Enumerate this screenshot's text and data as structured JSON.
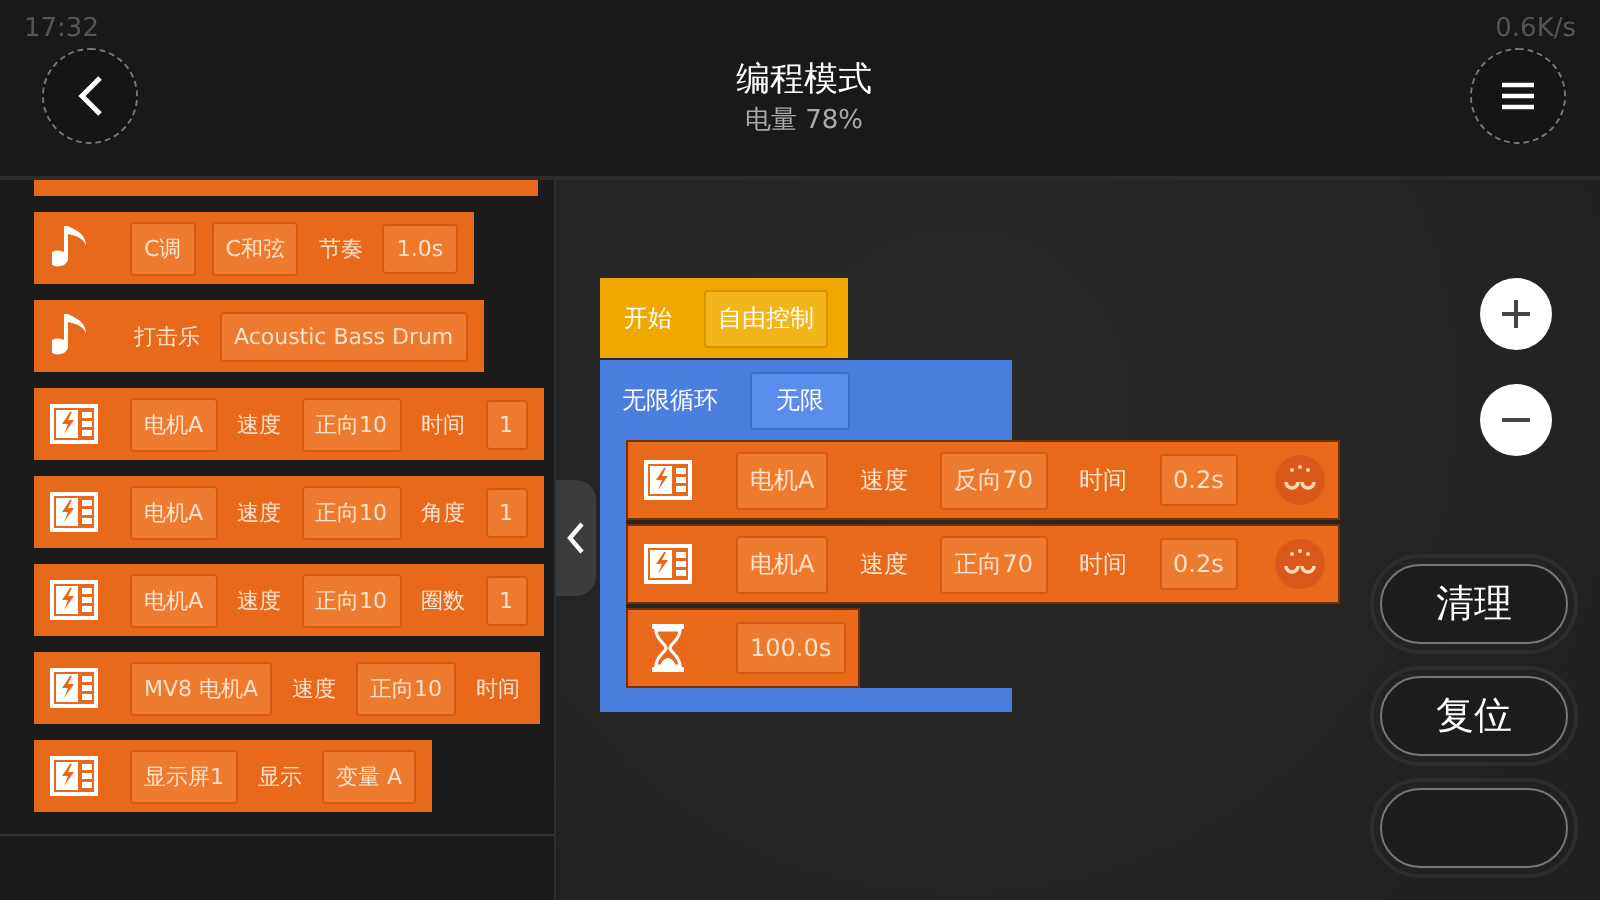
{
  "status_bar": {
    "time": "17:32",
    "net_speed": "0.6K/s"
  },
  "header": {
    "title": "编程模式",
    "subtitle": "电量 78%"
  },
  "palette": {
    "blocks": [
      {
        "kind": "partial"
      },
      {
        "kind": "note",
        "items": [
          {
            "kind": "field",
            "text": "C调"
          },
          {
            "kind": "field",
            "text": "C和弦"
          },
          {
            "kind": "label",
            "text": "节奏"
          },
          {
            "kind": "field",
            "text": "1.0s"
          }
        ]
      },
      {
        "kind": "note",
        "items": [
          {
            "kind": "label",
            "text": "打击乐"
          },
          {
            "kind": "field",
            "text": "Acoustic Bass Drum"
          }
        ]
      },
      {
        "kind": "motor",
        "items": [
          {
            "kind": "field",
            "text": "电机A"
          },
          {
            "kind": "label",
            "text": "速度"
          },
          {
            "kind": "field",
            "text": "正向10"
          },
          {
            "kind": "label",
            "text": "时间"
          },
          {
            "kind": "field",
            "text": "1"
          }
        ]
      },
      {
        "kind": "motor",
        "items": [
          {
            "kind": "field",
            "text": "电机A"
          },
          {
            "kind": "label",
            "text": "速度"
          },
          {
            "kind": "field",
            "text": "正向10"
          },
          {
            "kind": "label",
            "text": "角度"
          },
          {
            "kind": "field",
            "text": "1"
          }
        ]
      },
      {
        "kind": "motor",
        "items": [
          {
            "kind": "field",
            "text": "电机A"
          },
          {
            "kind": "label",
            "text": "速度"
          },
          {
            "kind": "field",
            "text": "正向10"
          },
          {
            "kind": "label",
            "text": "圈数"
          },
          {
            "kind": "field",
            "text": "1"
          }
        ]
      },
      {
        "kind": "motor",
        "items": [
          {
            "kind": "field",
            "text": "MV8 电机A"
          },
          {
            "kind": "label",
            "text": "速度"
          },
          {
            "kind": "field",
            "text": "正向10"
          },
          {
            "kind": "label",
            "text": "时间"
          }
        ]
      },
      {
        "kind": "motor",
        "items": [
          {
            "kind": "field",
            "text": "显示屏1"
          },
          {
            "kind": "label",
            "text": "显示"
          },
          {
            "kind": "field",
            "text": "变量 A"
          }
        ]
      }
    ]
  },
  "program": {
    "start": {
      "label": "开始",
      "value": "自由控制"
    },
    "loop": {
      "label": "无限循环",
      "value": "无限",
      "children": [
        {
          "kind": "motor",
          "items": [
            {
              "kind": "field",
              "text": "电机A"
            },
            {
              "kind": "label",
              "text": "速度"
            },
            {
              "kind": "field",
              "text": "反向70"
            },
            {
              "kind": "label",
              "text": "时间"
            },
            {
              "kind": "field",
              "text": "0.2s"
            }
          ]
        },
        {
          "kind": "motor",
          "items": [
            {
              "kind": "field",
              "text": "电机A"
            },
            {
              "kind": "label",
              "text": "速度"
            },
            {
              "kind": "field",
              "text": "正向70"
            },
            {
              "kind": "label",
              "text": "时间"
            },
            {
              "kind": "field",
              "text": "0.2s"
            }
          ]
        },
        {
          "kind": "wait",
          "items": [
            {
              "kind": "field",
              "text": "100.0s"
            }
          ]
        }
      ]
    }
  },
  "side_buttons": [
    {
      "label": "清理"
    },
    {
      "label": "复位"
    }
  ]
}
